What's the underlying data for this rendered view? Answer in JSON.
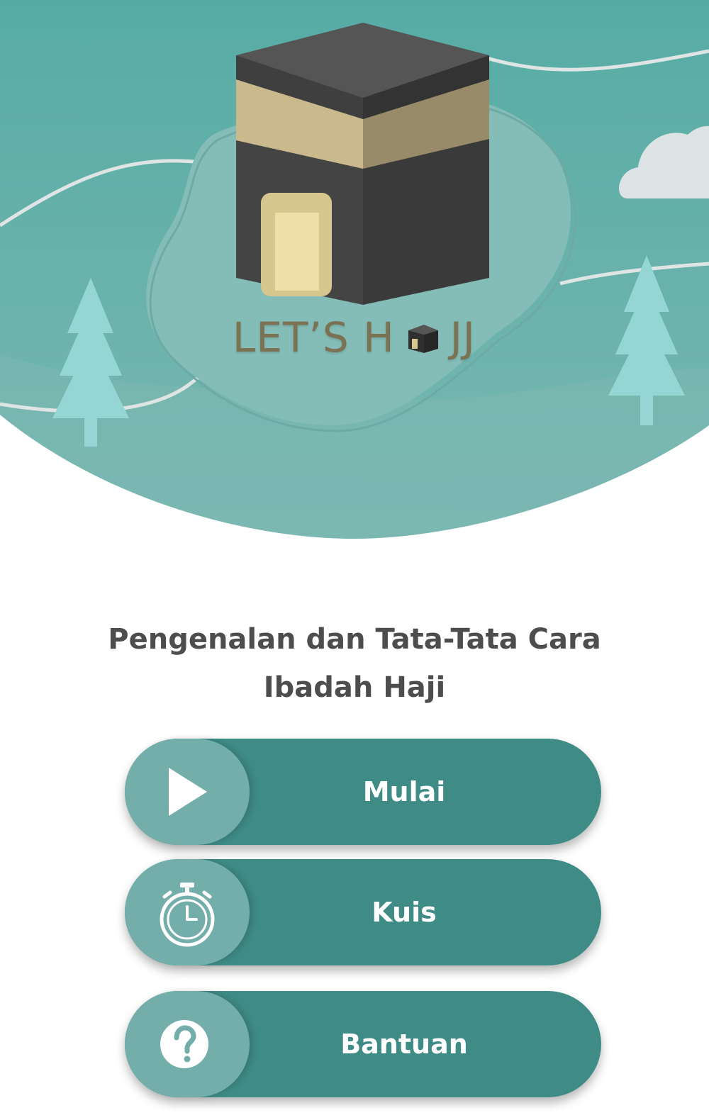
{
  "hero": {
    "logo_text_left": "LET’S H",
    "logo_text_right": "JJ"
  },
  "title_line1": "Pengenalan dan Tata-Tata Cara",
  "title_line2": "Ibadah Haji",
  "buttons": [
    {
      "label": "Mulai",
      "icon": "play-icon"
    },
    {
      "label": "Kuis",
      "icon": "stopwatch-icon"
    },
    {
      "label": "Bantuan",
      "icon": "help-icon"
    }
  ],
  "colors": {
    "hero_teal": "#5aaea7",
    "button_dark": "#3f8b86",
    "button_light": "#73aeaa",
    "title_text": "#4d4d4d",
    "logo_text": "#7a6a48"
  }
}
